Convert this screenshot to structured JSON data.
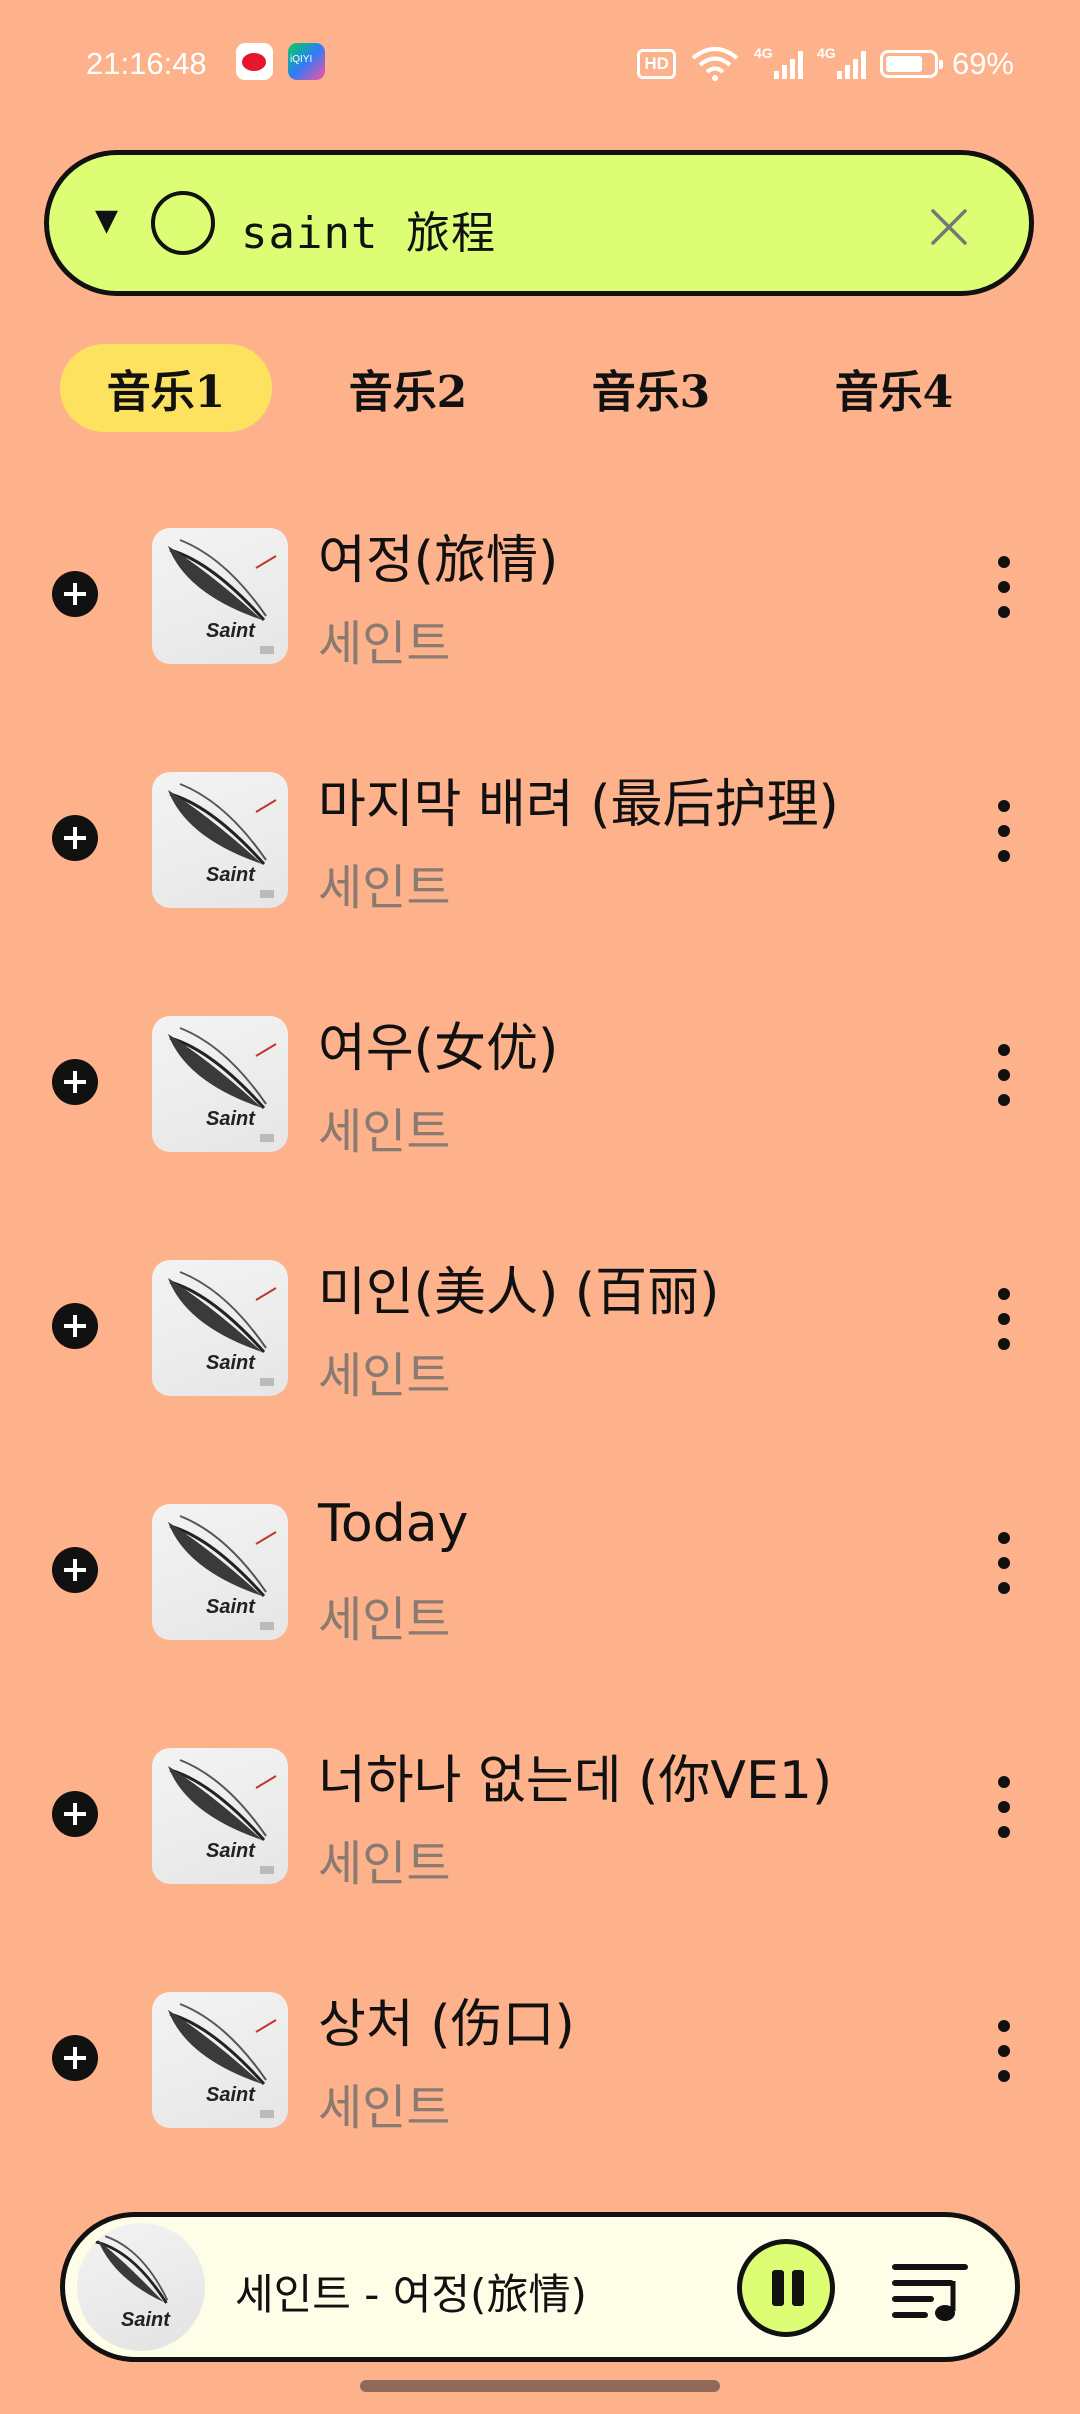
{
  "status_bar": {
    "time": "21:16:48",
    "hd_label": "HD",
    "net1": "4G",
    "net2": "4G",
    "battery": "69%",
    "battery_fill": 0.69
  },
  "search": {
    "query": "saint 旅程",
    "icons": [
      "dropdown-caret-icon",
      "circle-icon",
      "clear-icon"
    ]
  },
  "tabs": [
    {
      "label": "音乐1",
      "active": true
    },
    {
      "label": "音乐2",
      "active": false
    },
    {
      "label": "音乐3",
      "active": false
    },
    {
      "label": "音乐4",
      "active": false
    }
  ],
  "songs": [
    {
      "title": "여정(旅情)",
      "artist": "세인트",
      "cover_text": "Saint"
    },
    {
      "title": "마지막 배려 (最后护理)",
      "artist": "세인트",
      "cover_text": "Saint"
    },
    {
      "title": "여우(女优)",
      "artist": "세인트",
      "cover_text": "Saint"
    },
    {
      "title": "미인(美人) (百丽)",
      "artist": "세인트",
      "cover_text": "Saint"
    },
    {
      "title": "Today",
      "artist": "세인트",
      "cover_text": "Saint"
    },
    {
      "title": "너하나 없는데 (你VE1)",
      "artist": "세인트",
      "cover_text": "Saint"
    },
    {
      "title": "상처 (伤口)",
      "artist": "세인트",
      "cover_text": "Saint"
    }
  ],
  "player": {
    "now_playing": "세인트 - 여정(旅情)",
    "cover_text": "Saint"
  },
  "colors": {
    "background": "#fdb28b",
    "search_bg": "#dcfd74",
    "active_tab": "#fde260",
    "player_bg": "#fefde8"
  }
}
